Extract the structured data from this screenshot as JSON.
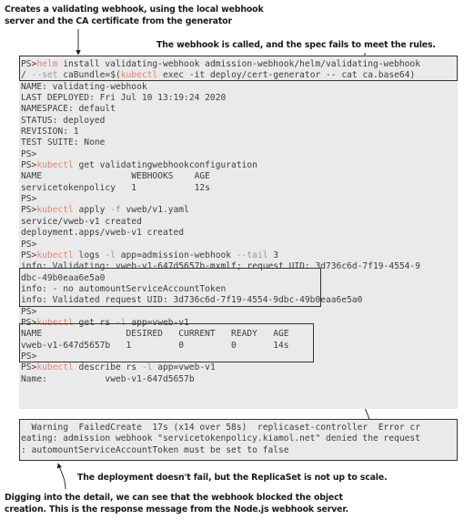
{
  "captions": {
    "top_left": "Creates a validating webhook, using the local webhook\nserver and the CA certificate from the generator",
    "top_right": "The webhook is called, and the spec fails to meet the rules.",
    "replicaset": "The deployment doesn't fail, but the ReplicaSet is not up to scale.",
    "bottom": "Digging into the detail, we can see that the webhook blocked the object\ncreation. This is the response message from the Node.js webhook server."
  },
  "colors": {
    "terminal_background": "#eaeaea",
    "terminal_text": "#3c3c3c",
    "command_accent": "#e8836a",
    "flag_accent": "#8c9aa8",
    "box_border": "#333333",
    "page_background": "#ffffff"
  },
  "terminal": {
    "prompt": "PS>",
    "lines": [
      {
        "id": "l01",
        "prompt": "PS>",
        "cmd": "helm",
        "rest": " install validating-webhook admission-webhook/helm/validating-webhook"
      },
      {
        "id": "l02",
        "prompt": "",
        "pre": "/ ",
        "flag": "--set",
        "rest2": " caBundle=$(",
        "cmd": "kubectl",
        "rest": " exec -it deploy/cert-generator -- cat ca.base64)"
      },
      {
        "id": "l03",
        "text": "NAME: validating-webhook"
      },
      {
        "id": "l04",
        "text": "LAST DEPLOYED: Fri Jul 10 13:19:24 2020"
      },
      {
        "id": "l05",
        "text": "NAMESPACE: default"
      },
      {
        "id": "l06",
        "text": "STATUS: deployed"
      },
      {
        "id": "l07",
        "text": "REVISION: 1"
      },
      {
        "id": "l08",
        "text": "TEST SUITE: None"
      },
      {
        "id": "l09",
        "prompt": "PS>",
        "rest": ""
      },
      {
        "id": "l10",
        "prompt": "PS>",
        "cmd": "kubectl",
        "rest": " get validatingwebhookconfiguration"
      },
      {
        "id": "l11",
        "text": "NAME                 WEBHOOKS    AGE"
      },
      {
        "id": "l12",
        "text": "servicetokenpolicy   1           12s"
      },
      {
        "id": "l13",
        "prompt": "PS>",
        "rest": ""
      },
      {
        "id": "l14",
        "prompt": "PS>",
        "cmd": "kubectl",
        "rest": " apply ",
        "flag": "-f",
        "rest2": " vweb/v1.yaml",
        "order": "flagmid"
      },
      {
        "id": "l15",
        "text": "service/vweb-v1 created"
      },
      {
        "id": "l16",
        "text": "deployment.apps/vweb-v1 created"
      },
      {
        "id": "l17",
        "prompt": "PS>",
        "rest": ""
      },
      {
        "id": "l18",
        "prompt": "PS>",
        "cmd": "kubectl",
        "rest": " logs ",
        "flag": "-l",
        "rest2": " app=admission-webhook ",
        "flag2": "--tail",
        "rest3": " 3",
        "order": "flagmid"
      },
      {
        "id": "l19",
        "text": "info: Validating: vweb-v1-647d5657b-mxmlf; request UID: 3d736c6d-7f19-4554-9"
      },
      {
        "id": "l20",
        "text": "dbc-49b0eaa6e5a0"
      },
      {
        "id": "l21",
        "text": "info: - no automountServiceAccountToken"
      },
      {
        "id": "l22",
        "text": "info: Validated request UID: 3d736c6d-7f19-4554-9dbc-49b0eaa6e5a0"
      },
      {
        "id": "l23",
        "prompt": "PS>",
        "rest": ""
      },
      {
        "id": "l24",
        "prompt": "PS>",
        "cmd": "kubectl",
        "rest": " get rs ",
        "flag": "-l",
        "rest2": " app=vweb-v1",
        "order": "flagmid"
      },
      {
        "id": "l25",
        "text": "NAME                DESIRED   CURRENT   READY   AGE"
      },
      {
        "id": "l26",
        "text": "vweb-v1-647d5657b   1         0         0       14s"
      },
      {
        "id": "l27",
        "prompt": "PS>",
        "rest": ""
      },
      {
        "id": "l28",
        "prompt": "PS>",
        "cmd": "kubectl",
        "rest": " describe rs ",
        "flag": "-l",
        "rest2": " app=vweb-v1",
        "order": "flagmid"
      },
      {
        "id": "l29",
        "text": "Name:           vweb-v1-647d5657b"
      }
    ],
    "warning_lines": [
      {
        "id": "w01",
        "text": "  Warning  FailedCreate  17s (x14 over 58s)  replicaset-controller  Error cr"
      },
      {
        "id": "w02",
        "text": "eating: admission webhook \"servicetokenpolicy.kiamol.net\" denied the request"
      },
      {
        "id": "w03",
        "text": ": automountServiceAccountToken must be set to false"
      }
    ]
  },
  "highlights": [
    {
      "id": "helm-command",
      "label": "helm install highlight"
    },
    {
      "id": "logs-output",
      "label": "webhook logs highlight"
    },
    {
      "id": "replicaset-output",
      "label": "replicaset status highlight"
    },
    {
      "id": "warning-event",
      "label": "failed create warning highlight"
    }
  ]
}
